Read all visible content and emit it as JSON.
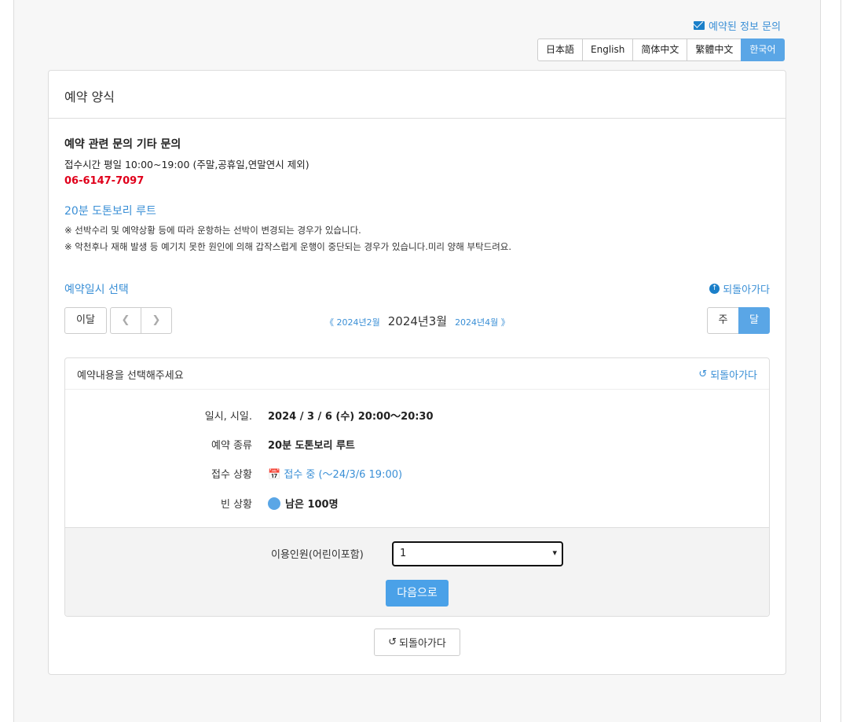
{
  "header": {
    "inquiry_link": "예약된 정보 문의",
    "languages": [
      "日本語",
      "English",
      "简体中文",
      "繁體中文",
      "한국어"
    ],
    "active_language": "한국어"
  },
  "panel": {
    "title": "예약 양식",
    "contact_title": "예약 관련 문의 기타 문의",
    "hours": "접수시간 평일 10:00~19:00 (주말,공휴일,연말연시 제외)",
    "phone": "06-6147-7097",
    "route_name": "20분 도톤보리 루트",
    "notes": [
      "※ 선박수리 및 예약상황 등에 따라 운항하는 선박이 변경되는 경우가 있습니다.",
      "※ 악천후나 재해 발생 등 예기치 못한 원인에 의해 갑작스럽게 운행이 중단되는 경우가 있습니다.미리 양해 부탁드려요."
    ]
  },
  "calendar": {
    "section_title": "예약일시 선택",
    "back_label": "되돌아가다",
    "this_month": "이달",
    "prev_icon": "chevron-left-icon",
    "next_icon": "chevron-right-icon",
    "prev_month": "《 2024년2월",
    "current_month": "2024년3월",
    "next_month": "2024년4월 》",
    "view_week": "주",
    "view_month": "달",
    "active_view": "달"
  },
  "detail": {
    "heading": "예약내용을 선택해주세요",
    "back_label": "되돌아가다",
    "rows": [
      {
        "key": "일시, 시일.",
        "value": "2024 / 3 / 6 (수) 20:00〜20:30"
      },
      {
        "key": "예약 종류",
        "value": "20분 도톤보리 루트"
      },
      {
        "key": "접수 상황",
        "value": "접수 중 (〜24/3/6 19:00)"
      },
      {
        "key": "빈 상황",
        "value": "남은 100명"
      }
    ],
    "users_label": "이용인원(어린이포함)",
    "users_value": "1",
    "next_label": "다음으로"
  },
  "bottom_back": "되돌아가다",
  "colors": {
    "accent": "#3a8fd6",
    "active_button": "#5aa6e6",
    "phone": "#e0001b",
    "next_button": "#4aa1e8"
  }
}
